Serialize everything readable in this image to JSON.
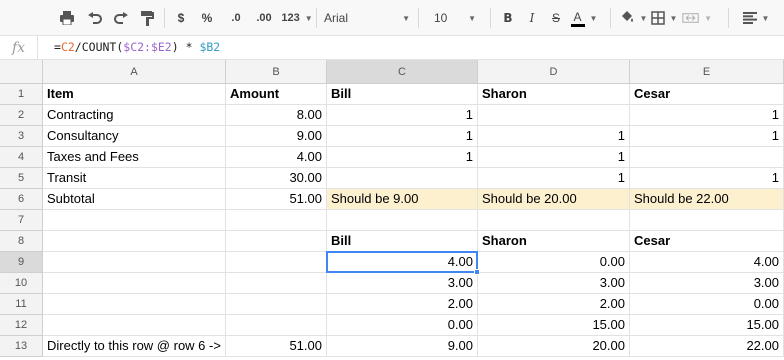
{
  "toolbar": {
    "font_name": "Arial",
    "font_size": "10",
    "currency_label": "$",
    "percent_label": "%",
    "decrease_decimals_label": ".0",
    "increase_decimals_label": ".00",
    "more_formats_label": "123",
    "bold_label": "B",
    "italic_label": "I",
    "strike_label": "S",
    "text_color_label": "A"
  },
  "formula_bar": {
    "fx_label": "fx",
    "f0": "=",
    "f1": "C2",
    "f2": "/COUNT(",
    "f3": "$C2:$E2",
    "f4": ") * ",
    "f5": "$B2"
  },
  "columns": [
    "A",
    "B",
    "C",
    "D",
    "E"
  ],
  "rows": [
    {
      "num": "1",
      "cells": [
        "Item",
        "Amount",
        "Bill",
        "Sharon",
        "Cesar"
      ]
    },
    {
      "num": "2",
      "cells": [
        "Contracting",
        "8.00",
        "1",
        "",
        "1"
      ]
    },
    {
      "num": "3",
      "cells": [
        "Consultancy",
        "9.00",
        "1",
        "1",
        "1"
      ]
    },
    {
      "num": "4",
      "cells": [
        "Taxes and Fees",
        "4.00",
        "1",
        "1",
        ""
      ]
    },
    {
      "num": "5",
      "cells": [
        "Transit",
        "30.00",
        "",
        "1",
        "1"
      ]
    },
    {
      "num": "6",
      "cells": [
        "Subtotal",
        "51.00",
        "Should be 9.00",
        "Should be 20.00",
        "Should be 22.00"
      ]
    },
    {
      "num": "7",
      "cells": [
        "",
        "",
        "",
        "",
        ""
      ]
    },
    {
      "num": "8",
      "cells": [
        "",
        "",
        "Bill",
        "Sharon",
        "Cesar"
      ]
    },
    {
      "num": "9",
      "cells": [
        "",
        "",
        "4.00",
        "0.00",
        "4.00"
      ]
    },
    {
      "num": "10",
      "cells": [
        "",
        "",
        "3.00",
        "3.00",
        "3.00"
      ]
    },
    {
      "num": "11",
      "cells": [
        "",
        "",
        "2.00",
        "2.00",
        "0.00"
      ]
    },
    {
      "num": "12",
      "cells": [
        "",
        "",
        "0.00",
        "15.00",
        "15.00"
      ]
    },
    {
      "num": "13",
      "cells": [
        "Directly to this row @ row 6 ->",
        "51.00",
        "9.00",
        "20.00",
        "22.00"
      ]
    }
  ],
  "selected_cell": "C9",
  "colors": {
    "selection": "#4285f4",
    "highlight": "#fcf0cf"
  }
}
